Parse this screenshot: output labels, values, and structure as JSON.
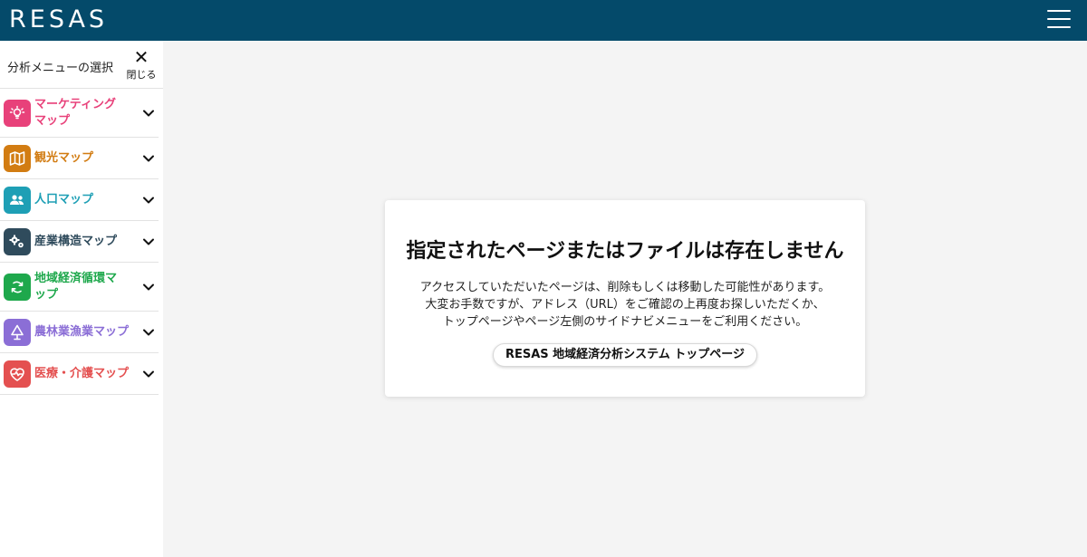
{
  "header": {
    "logo_text": "RESAS",
    "menu_icon": "hamburger-menu-icon",
    "background": "#044a6a"
  },
  "sidebar": {
    "title": "分析メニューの選択",
    "close_label": "閉じる",
    "close_glyph": "✕",
    "items": [
      {
        "label": "マーケティングマップ",
        "icon": "lightbulb-icon",
        "color": "#e8417a"
      },
      {
        "label": "観光マップ",
        "icon": "map-icon",
        "color": "#d27c12"
      },
      {
        "label": "人口マップ",
        "icon": "people-icon",
        "color": "#1e9fb5"
      },
      {
        "label": "産業構造マップ",
        "icon": "gears-icon",
        "color": "#2f4b5c"
      },
      {
        "label": "地域経済循環マップ",
        "icon": "recycle-icon",
        "color": "#1ea84c"
      },
      {
        "label": "農林業漁業マップ",
        "icon": "tree-icon",
        "color": "#8b6ed6"
      },
      {
        "label": "医療・介護マップ",
        "icon": "heart-pulse-icon",
        "color": "#e45050"
      }
    ]
  },
  "error": {
    "title": "指定されたページまたはファイルは存在しません",
    "lines": [
      "アクセスしていただいたページは、削除もしくは移動した可能性があります。",
      "大変お手数ですが、アドレス（URL）をご確認の上再度お探しいただくか、",
      "トップページやページ左側のサイドナビメニューをご利用ください。"
    ],
    "top_link_label": "RESAS 地域経済分析システム トップページ"
  }
}
